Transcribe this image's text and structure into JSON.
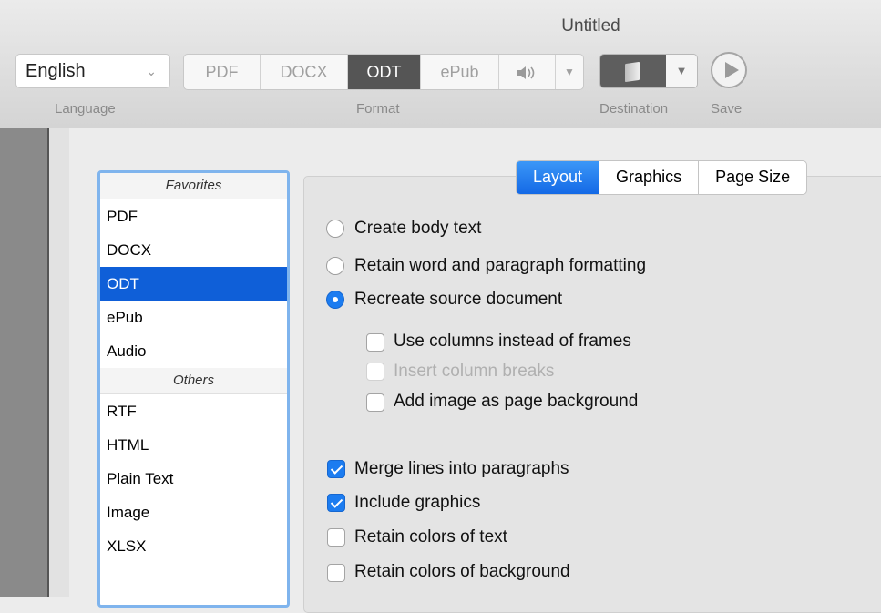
{
  "window": {
    "title": "Untitled"
  },
  "toolbar": {
    "language": {
      "value": "English",
      "caption": "Language"
    },
    "format": {
      "caption": "Format",
      "options": [
        "PDF",
        "DOCX",
        "ODT",
        "ePub"
      ],
      "selected": "ODT",
      "audio_icon": "speaker-icon"
    },
    "destination": {
      "caption": "Destination",
      "icon": "book-icon"
    },
    "save": {
      "caption": "Save",
      "icon": "play-icon"
    }
  },
  "format_list": {
    "groups": [
      {
        "label": "Favorites",
        "items": [
          "PDF",
          "DOCX",
          "ODT",
          "ePub",
          "Audio"
        ]
      },
      {
        "label": "Others",
        "items": [
          "RTF",
          "HTML",
          "Plain Text",
          "Image",
          "XLSX"
        ]
      }
    ],
    "selected": "ODT",
    "selection_color": "#0f5fd8"
  },
  "tabs": {
    "items": [
      "Layout",
      "Graphics",
      "Page Size"
    ],
    "selected": "Layout",
    "accent": "#1c7cf0"
  },
  "layout": {
    "mode_options": [
      {
        "label": "Create body text",
        "checked": false
      },
      {
        "label": "Retain word and paragraph formatting",
        "checked": false
      },
      {
        "label": "Recreate source document",
        "checked": true
      }
    ],
    "sub_options": [
      {
        "label": "Use columns instead of frames",
        "checked": false,
        "enabled": true
      },
      {
        "label": "Insert column breaks",
        "checked": false,
        "enabled": false
      },
      {
        "label": "Add image as page background",
        "checked": false,
        "enabled": true
      }
    ],
    "checkboxes": [
      {
        "label": "Merge lines into paragraphs",
        "checked": true
      },
      {
        "label": "Include graphics",
        "checked": true
      },
      {
        "label": "Retain colors of text",
        "checked": false
      },
      {
        "label": "Retain colors of background",
        "checked": false
      }
    ]
  }
}
